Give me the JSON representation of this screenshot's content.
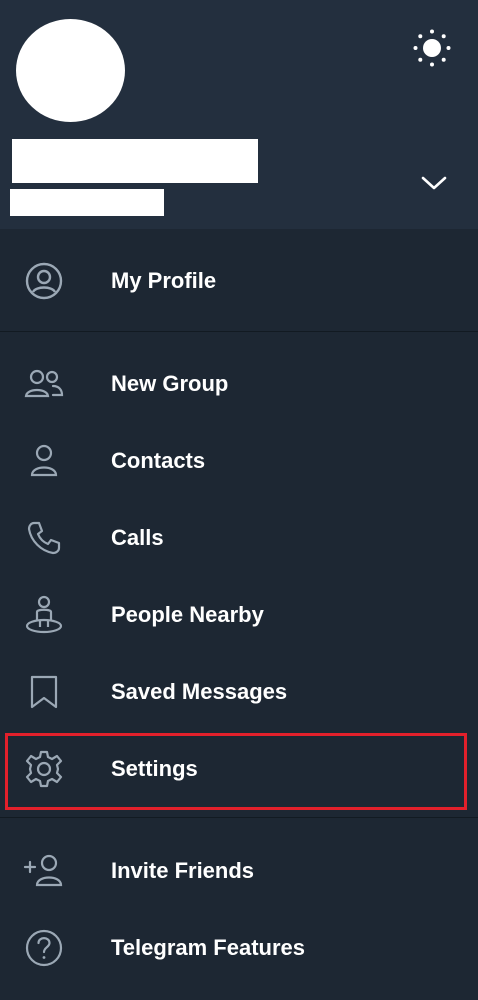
{
  "colors": {
    "header_bg": "#232f3e",
    "drawer_bg": "#1d2733",
    "icon_color": "#9ba8b5",
    "text_color": "#ffffff",
    "highlight": "#e2202b"
  },
  "header": {
    "theme_icon": "sun-icon",
    "expand_icon": "chevron-down-icon"
  },
  "menu": {
    "profile": {
      "label": "My Profile",
      "icon": "profile-icon"
    },
    "items": [
      {
        "label": "New Group",
        "icon": "group-icon"
      },
      {
        "label": "Contacts",
        "icon": "contact-icon"
      },
      {
        "label": "Calls",
        "icon": "phone-icon"
      },
      {
        "label": "People Nearby",
        "icon": "people-nearby-icon"
      },
      {
        "label": "Saved Messages",
        "icon": "bookmark-icon"
      },
      {
        "label": "Settings",
        "icon": "gear-icon"
      }
    ],
    "footer": [
      {
        "label": "Invite Friends",
        "icon": "add-user-icon"
      },
      {
        "label": "Telegram Features",
        "icon": "question-icon"
      }
    ]
  }
}
